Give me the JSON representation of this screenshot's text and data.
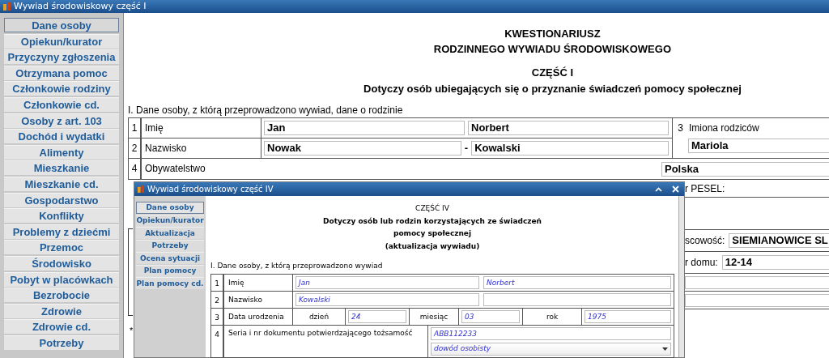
{
  "main_window": {
    "title": "Wywiad środowiskowy część I",
    "sidebar": {
      "items": [
        {
          "label": "Dane osoby",
          "selected": true
        },
        {
          "label": "Opiekun/kurator",
          "selected": false
        },
        {
          "label": "Przyczyny zgłoszenia",
          "selected": false
        },
        {
          "label": "Otrzymana pomoc",
          "selected": false
        },
        {
          "label": "Członkowie rodziny",
          "selected": false
        },
        {
          "label": "Członkowie cd.",
          "selected": false
        },
        {
          "label": "Osoby z art. 103",
          "selected": false
        },
        {
          "label": "Dochód i wydatki",
          "selected": false
        },
        {
          "label": "Alimenty",
          "selected": false
        },
        {
          "label": "Mieszkanie",
          "selected": false
        },
        {
          "label": "Mieszkanie cd.",
          "selected": false
        },
        {
          "label": "Gospodarstwo",
          "selected": false
        },
        {
          "label": "Konflikty",
          "selected": false
        },
        {
          "label": "Problemy z dziećmi",
          "selected": false
        },
        {
          "label": "Przemoc",
          "selected": false
        },
        {
          "label": "Środowisko",
          "selected": false
        },
        {
          "label": "Pobyt w placówkach",
          "selected": false
        },
        {
          "label": "Bezrobocie",
          "selected": false
        },
        {
          "label": "Zdrowie",
          "selected": false
        },
        {
          "label": "Zdrowie cd.",
          "selected": false
        },
        {
          "label": "Potrzeby",
          "selected": false
        }
      ]
    },
    "form": {
      "headings": [
        "KWESTIONARIUSZ",
        "RODZINNEGO WYWIADU ŚRODOWISKOWEGO",
        "CZĘŚĆ I",
        "Dotyczy osób ubiegających się o przyznanie świadczeń pomocy społecznej"
      ],
      "section_title": "I. Dane osoby, z którą przeprowadzono wywiad, dane o rodzinie",
      "rows": [
        {
          "number": "1",
          "label": "Imię",
          "values": [
            "Jan",
            "Norbert"
          ]
        },
        {
          "number": "2",
          "label": "Nazwisko",
          "values": [
            "Nowak",
            "Kowalski"
          ],
          "separator": "-"
        }
      ],
      "parents": {
        "number": "3",
        "label": "Imiona rodziców",
        "value": "Mariola"
      },
      "citizenship": {
        "number": "4",
        "label": "Obywatelstwo",
        "value": "Polska"
      },
      "right_rows": [
        {
          "kind": "label",
          "label": "r PESEL:"
        },
        {
          "kind": "blank"
        },
        {
          "kind": "field",
          "label": "scowość:",
          "value": "SIEMIANOWICE SL"
        },
        {
          "kind": "field",
          "label": "r domu:",
          "value": "12-14"
        },
        {
          "kind": "empty_field"
        },
        {
          "kind": "empty_field"
        }
      ],
      "footnote": "*"
    }
  },
  "sub_window": {
    "title": "Wywiad środowiskowy część IV",
    "sidebar": {
      "items": [
        {
          "label": "Dane osoby",
          "selected": true
        },
        {
          "label": "Opiekun/kurator",
          "selected": false
        },
        {
          "label": "Aktualizacja",
          "selected": false
        },
        {
          "label": "Potrzeby",
          "selected": false
        },
        {
          "label": "Ocena sytuacji",
          "selected": false
        },
        {
          "label": "Plan pomocy",
          "selected": false
        },
        {
          "label": "Plan pomocy cd.",
          "selected": false
        }
      ]
    },
    "headings": [
      "CZĘŚĆ IV",
      "Dotyczy osób lub rodzin korzystających ze świadczeń",
      "pomocy społecznej",
      "(aktualizacja wywiadu)"
    ],
    "section_title": "I. Dane osoby, z którą przeprowadzono wywiad",
    "rows": [
      {
        "kind": "pair",
        "number": "1",
        "label": "Imię",
        "values": [
          "Jan",
          "Norbert"
        ]
      },
      {
        "kind": "pair",
        "number": "2",
        "label": "Nazwisko",
        "values": [
          "Kowalski"
        ]
      },
      {
        "kind": "date",
        "number": "3",
        "label": "Data urodzenia",
        "parts": [
          {
            "label": "dzień",
            "value": "24"
          },
          {
            "label": "miesiąc",
            "value": "03"
          },
          {
            "label": "rok",
            "value": "1975"
          }
        ]
      },
      {
        "kind": "document",
        "number": "4",
        "label": "Seria i nr dokumentu potwierdzającego tożsamość",
        "value": "ABB112233",
        "document_type": "dowód osobisty"
      }
    ]
  }
}
